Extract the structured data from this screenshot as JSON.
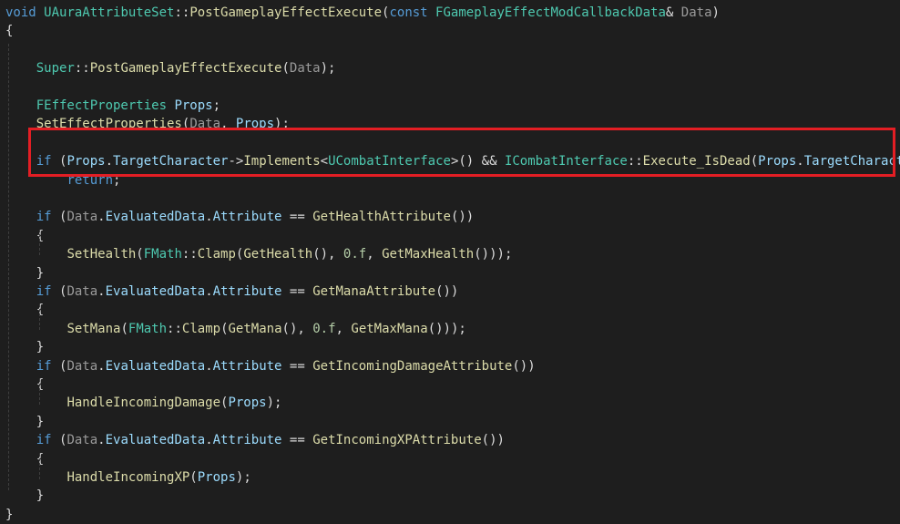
{
  "colors": {
    "background": "#1e1e1e",
    "keyword": "#569cd6",
    "type": "#4ec9b0",
    "function": "#dcdcaa",
    "parameter": "#9a9a9a",
    "variable": "#9cdcfe",
    "number": "#b5cea8",
    "plain": "#dcdcdc",
    "macro": "#bd63c5",
    "highlight_border": "#e31e24"
  },
  "code": {
    "lines": [
      [
        [
          "void ",
          "keyword"
        ],
        [
          "UAuraAttributeSet",
          "type"
        ],
        [
          "::",
          "plain"
        ],
        [
          "PostGameplayEffectExecute",
          "function"
        ],
        [
          "(",
          "plain"
        ],
        [
          "const ",
          "keyword"
        ],
        [
          "FGameplayEffectModCallbackData",
          "type"
        ],
        [
          "& ",
          "plain"
        ],
        [
          "Data",
          "parameter"
        ],
        [
          ")",
          "plain"
        ]
      ],
      [
        [
          "{",
          "plain"
        ]
      ],
      [],
      [
        [
          "    ",
          "plain"
        ],
        [
          "Super",
          "type"
        ],
        [
          "::",
          "plain"
        ],
        [
          "PostGameplayEffectExecute",
          "function"
        ],
        [
          "(",
          "plain"
        ],
        [
          "Data",
          "parameter"
        ],
        [
          ");",
          "plain"
        ]
      ],
      [],
      [
        [
          "    ",
          "plain"
        ],
        [
          "FEffectProperties ",
          "type"
        ],
        [
          "Props",
          "variable"
        ],
        [
          ";",
          "plain"
        ]
      ],
      [
        [
          "    ",
          "plain"
        ],
        [
          "SetEffectProperties",
          "function"
        ],
        [
          "(",
          "plain"
        ],
        [
          "Data",
          "parameter"
        ],
        [
          ", ",
          "plain"
        ],
        [
          "Props",
          "variable"
        ],
        [
          ");",
          "plain"
        ]
      ],
      [],
      [
        [
          "    ",
          "plain"
        ],
        [
          "if ",
          "keyword"
        ],
        [
          "(",
          "plain"
        ],
        [
          "Props",
          "variable"
        ],
        [
          ".",
          "plain"
        ],
        [
          "TargetCharacter",
          "variable"
        ],
        [
          "->",
          "plain"
        ],
        [
          "Implements",
          "function"
        ],
        [
          "<",
          "plain"
        ],
        [
          "UCombatInterface",
          "type"
        ],
        [
          ">() && ",
          "plain"
        ],
        [
          "ICombatInterface",
          "type"
        ],
        [
          "::",
          "plain"
        ],
        [
          "Execute_IsDead",
          "function"
        ],
        [
          "(",
          "plain"
        ],
        [
          "Props",
          "variable"
        ],
        [
          ".",
          "plain"
        ],
        [
          "TargetCharacter",
          "variable"
        ],
        [
          "))",
          "plain"
        ]
      ],
      [
        [
          "        ",
          "plain"
        ],
        [
          "return",
          "keyword"
        ],
        [
          ";",
          "plain"
        ]
      ],
      [],
      [
        [
          "    ",
          "plain"
        ],
        [
          "if ",
          "keyword"
        ],
        [
          "(",
          "plain"
        ],
        [
          "Data",
          "parameter"
        ],
        [
          ".",
          "plain"
        ],
        [
          "EvaluatedData",
          "variable"
        ],
        [
          ".",
          "plain"
        ],
        [
          "Attribute ",
          "variable"
        ],
        [
          "== ",
          "plain"
        ],
        [
          "GetHealthAttribute",
          "function"
        ],
        [
          "())",
          "plain"
        ]
      ],
      [
        [
          "    ",
          "plain"
        ],
        [
          "{",
          "plain"
        ]
      ],
      [
        [
          "        ",
          "plain"
        ],
        [
          "SetHealth",
          "function"
        ],
        [
          "(",
          "plain"
        ],
        [
          "FMath",
          "type"
        ],
        [
          "::",
          "plain"
        ],
        [
          "Clamp",
          "function"
        ],
        [
          "(",
          "plain"
        ],
        [
          "GetHealth",
          "function"
        ],
        [
          "(), ",
          "plain"
        ],
        [
          "0.f",
          "number"
        ],
        [
          ", ",
          "plain"
        ],
        [
          "GetMaxHealth",
          "function"
        ],
        [
          "()));",
          "plain"
        ]
      ],
      [
        [
          "    ",
          "plain"
        ],
        [
          "}",
          "plain"
        ]
      ],
      [
        [
          "    ",
          "plain"
        ],
        [
          "if ",
          "keyword"
        ],
        [
          "(",
          "plain"
        ],
        [
          "Data",
          "parameter"
        ],
        [
          ".",
          "plain"
        ],
        [
          "EvaluatedData",
          "variable"
        ],
        [
          ".",
          "plain"
        ],
        [
          "Attribute ",
          "variable"
        ],
        [
          "== ",
          "plain"
        ],
        [
          "GetManaAttribute",
          "function"
        ],
        [
          "())",
          "plain"
        ]
      ],
      [
        [
          "    ",
          "plain"
        ],
        [
          "{",
          "plain"
        ]
      ],
      [
        [
          "        ",
          "plain"
        ],
        [
          "SetMana",
          "function"
        ],
        [
          "(",
          "plain"
        ],
        [
          "FMath",
          "type"
        ],
        [
          "::",
          "plain"
        ],
        [
          "Clamp",
          "function"
        ],
        [
          "(",
          "plain"
        ],
        [
          "GetMana",
          "function"
        ],
        [
          "(), ",
          "plain"
        ],
        [
          "0.f",
          "number"
        ],
        [
          ", ",
          "plain"
        ],
        [
          "GetMaxMana",
          "function"
        ],
        [
          "()));",
          "plain"
        ]
      ],
      [
        [
          "    ",
          "plain"
        ],
        [
          "}",
          "plain"
        ]
      ],
      [
        [
          "    ",
          "plain"
        ],
        [
          "if ",
          "keyword"
        ],
        [
          "(",
          "plain"
        ],
        [
          "Data",
          "parameter"
        ],
        [
          ".",
          "plain"
        ],
        [
          "EvaluatedData",
          "variable"
        ],
        [
          ".",
          "plain"
        ],
        [
          "Attribute ",
          "variable"
        ],
        [
          "== ",
          "plain"
        ],
        [
          "GetIncomingDamageAttribute",
          "function"
        ],
        [
          "())",
          "plain"
        ]
      ],
      [
        [
          "    ",
          "plain"
        ],
        [
          "{",
          "plain"
        ]
      ],
      [
        [
          "        ",
          "plain"
        ],
        [
          "HandleIncomingDamage",
          "function"
        ],
        [
          "(",
          "plain"
        ],
        [
          "Props",
          "variable"
        ],
        [
          ");",
          "plain"
        ]
      ],
      [
        [
          "    ",
          "plain"
        ],
        [
          "}",
          "plain"
        ]
      ],
      [
        [
          "    ",
          "plain"
        ],
        [
          "if ",
          "keyword"
        ],
        [
          "(",
          "plain"
        ],
        [
          "Data",
          "parameter"
        ],
        [
          ".",
          "plain"
        ],
        [
          "EvaluatedData",
          "variable"
        ],
        [
          ".",
          "plain"
        ],
        [
          "Attribute ",
          "variable"
        ],
        [
          "== ",
          "plain"
        ],
        [
          "GetIncomingXPAttribute",
          "function"
        ],
        [
          "())",
          "plain"
        ]
      ],
      [
        [
          "    ",
          "plain"
        ],
        [
          "{",
          "plain"
        ]
      ],
      [
        [
          "        ",
          "plain"
        ],
        [
          "HandleIncomingXP",
          "function"
        ],
        [
          "(",
          "plain"
        ],
        [
          "Props",
          "variable"
        ],
        [
          ");",
          "plain"
        ]
      ],
      [
        [
          "    ",
          "plain"
        ],
        [
          "}",
          "plain"
        ]
      ],
      [
        [
          "}",
          "plain"
        ]
      ]
    ]
  }
}
